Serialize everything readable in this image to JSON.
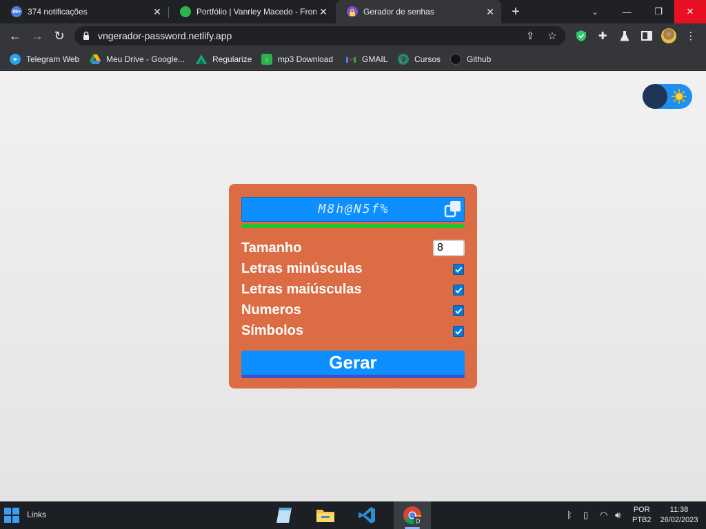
{
  "browser": {
    "tabs": [
      {
        "title": "374 notificações",
        "badge": "99+",
        "active": false
      },
      {
        "title": "Portfólio | Vanrley Macedo - Front",
        "active": false
      },
      {
        "title": "Gerador de senhas",
        "active": true
      }
    ],
    "url": "vngerador-password.netlify.app",
    "bookmarks": [
      {
        "label": "Telegram Web"
      },
      {
        "label": "Meu Drive - Google..."
      },
      {
        "label": "Regularize"
      },
      {
        "label": "mp3 Download"
      },
      {
        "label": "GMAIL"
      },
      {
        "label": "Cursos"
      },
      {
        "label": "Github"
      }
    ]
  },
  "app": {
    "password": "M8h@N5f%",
    "strength_fraction": 1.0,
    "options": [
      {
        "label": "Tamanho",
        "type": "number",
        "value": "8"
      },
      {
        "label": "Letras minúsculas",
        "type": "checkbox",
        "checked": true
      },
      {
        "label": "Letras maiúsculas",
        "type": "checkbox",
        "checked": true
      },
      {
        "label": "Numeros",
        "type": "checkbox",
        "checked": true
      },
      {
        "label": "Símbolos",
        "type": "checkbox",
        "checked": true
      }
    ],
    "generate_label": "Gerar",
    "colors": {
      "card": "#dc6c43",
      "accent": "#0d8fff",
      "strength": "#1ec42a"
    }
  },
  "taskbar": {
    "links_label": "Links",
    "lang_line1": "POR",
    "lang_line2": "PTB2",
    "time": "11:38",
    "date": "26/02/2023"
  }
}
